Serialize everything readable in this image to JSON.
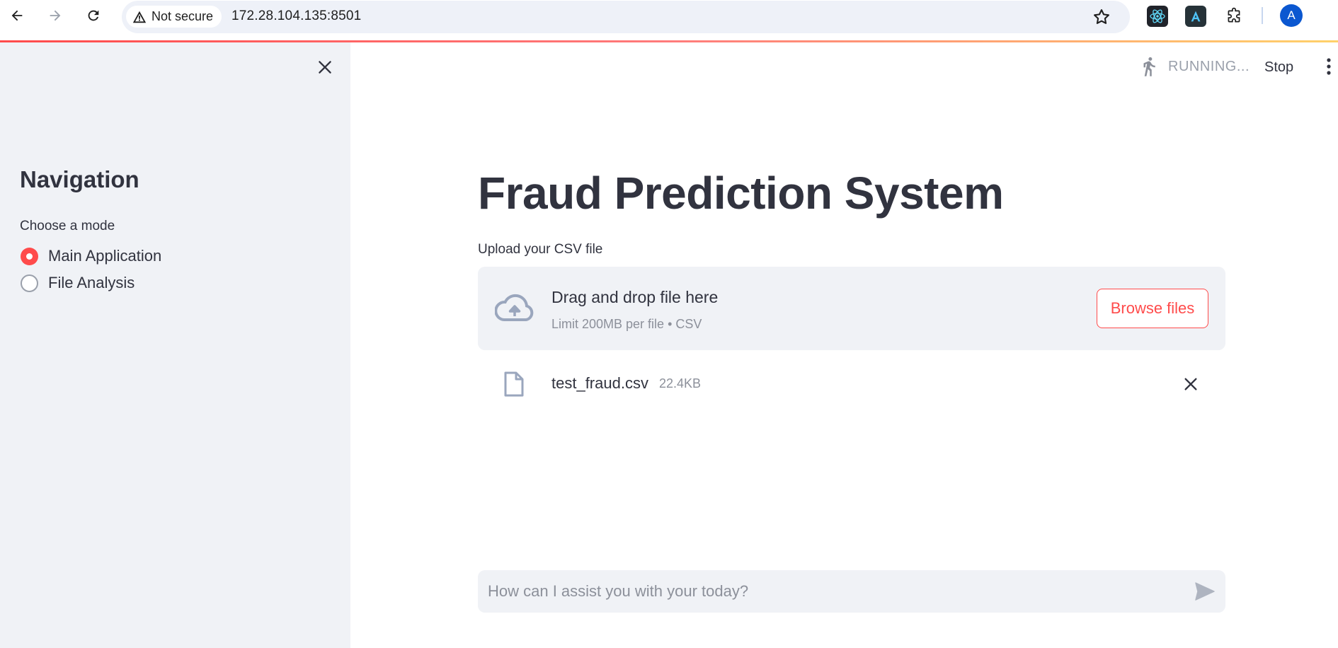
{
  "browser": {
    "security_label": "Not secure",
    "url": "172.28.104.135:8501",
    "avatar_letter": "A",
    "extensions": [
      "react-devtools-icon",
      "extension-a-icon",
      "extensions-puzzle-icon"
    ]
  },
  "colors": {
    "accent": "#ff4b4b",
    "sidebar_bg": "#f0f2f6",
    "text": "#31333f",
    "muted": "#8c909a"
  },
  "sidebar": {
    "title": "Navigation",
    "mode_label": "Choose a mode",
    "modes": [
      {
        "label": "Main Application",
        "selected": true
      },
      {
        "label": "File Analysis",
        "selected": false
      }
    ]
  },
  "header": {
    "status": "RUNNING...",
    "stop_label": "Stop"
  },
  "main": {
    "title": "Fraud Prediction System",
    "upload_label": "Upload your CSV file",
    "dropzone": {
      "primary": "Drag and drop file here",
      "secondary": "Limit 200MB per file • CSV",
      "browse_label": "Browse files"
    },
    "file": {
      "name": "test_fraud.csv",
      "size": "22.4KB"
    }
  },
  "chat": {
    "placeholder": "How can I assist you with your today?"
  }
}
